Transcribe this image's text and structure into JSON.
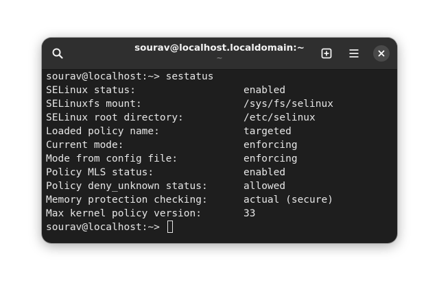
{
  "window": {
    "title": "sourav@localhost.localdomain:~",
    "subtitle": "~"
  },
  "headerbar": {
    "icons": {
      "search": "search-icon",
      "new_tab": "new-tab-icon",
      "menu": "hamburger-menu-icon",
      "close": "close-icon"
    }
  },
  "terminal": {
    "command_line": {
      "prompt": "sourav@localhost:~> ",
      "command": "sestatus"
    },
    "output": [
      {
        "key": "SELinux status:",
        "value": "enabled"
      },
      {
        "key": "SELinuxfs mount:",
        "value": "/sys/fs/selinux"
      },
      {
        "key": "SELinux root directory:",
        "value": "/etc/selinux"
      },
      {
        "key": "Loaded policy name:",
        "value": "targeted"
      },
      {
        "key": "Current mode:",
        "value": "enforcing"
      },
      {
        "key": "Mode from config file:",
        "value": "enforcing"
      },
      {
        "key": "Policy MLS status:",
        "value": "enabled"
      },
      {
        "key": "Policy deny_unknown status:",
        "value": "allowed"
      },
      {
        "key": "Memory protection checking:",
        "value": "actual (secure)"
      },
      {
        "key": "Max kernel policy version:",
        "value": "33"
      }
    ],
    "final_prompt": "sourav@localhost:~> "
  },
  "colors": {
    "terminal_bg": "#1e1e1e",
    "headerbar_bg": "#2f2f2f",
    "text": "#e6e6e6"
  }
}
